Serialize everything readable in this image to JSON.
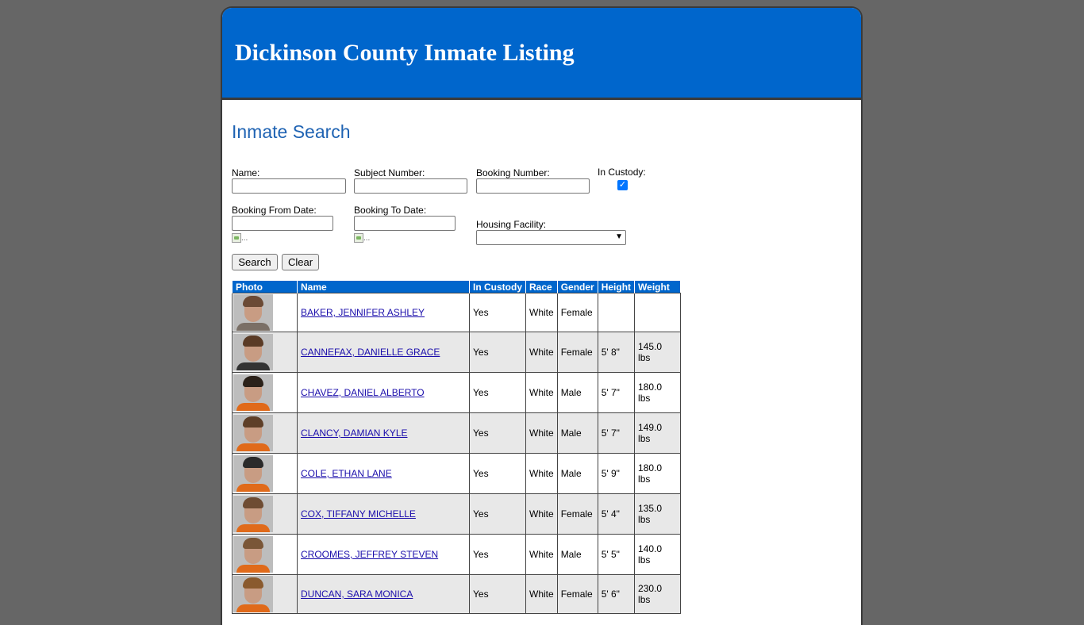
{
  "header": {
    "title": "Dickinson County Inmate Listing"
  },
  "search": {
    "title": "Inmate Search",
    "name_label": "Name:",
    "subject_label": "Subject Number:",
    "booking_label": "Booking Number:",
    "custody_label": "In Custody:",
    "from_label": "Booking From Date:",
    "to_label": "Booking To Date:",
    "housing_label": "Housing Facility:",
    "cal_alt": "...",
    "search_button": "Search",
    "clear_button": "Clear",
    "in_custody_checked": true
  },
  "table": {
    "headers": [
      "Photo",
      "Name",
      "In Custody",
      "Race",
      "Gender",
      "Height",
      "Weight"
    ],
    "rows": [
      {
        "name": "BAKER, JENNIFER ASHLEY",
        "custody": "Yes",
        "race": "White",
        "gender": "Female",
        "height": "",
        "weight": "",
        "hair": "#6b4a35",
        "shirt": "#7a6f66"
      },
      {
        "name": "CANNEFAX, DANIELLE GRACE",
        "custody": "Yes",
        "race": "White",
        "gender": "Female",
        "height": "5' 8\"",
        "weight": "145.0 lbs",
        "hair": "#5a3b26",
        "shirt": "#333333"
      },
      {
        "name": "CHAVEZ, DANIEL ALBERTO",
        "custody": "Yes",
        "race": "White",
        "gender": "Male",
        "height": "5' 7\"",
        "weight": "180.0 lbs",
        "hair": "#2b2119",
        "shirt": "#e06a1a"
      },
      {
        "name": "CLANCY, DAMIAN KYLE",
        "custody": "Yes",
        "race": "White",
        "gender": "Male",
        "height": "5' 7\"",
        "weight": "149.0 lbs",
        "hair": "#5e3f28",
        "shirt": "#e06a1a"
      },
      {
        "name": "COLE, ETHAN LANE",
        "custody": "Yes",
        "race": "White",
        "gender": "Male",
        "height": "5' 9\"",
        "weight": "180.0 lbs",
        "hair": "#2a2a2a",
        "shirt": "#e06a1a"
      },
      {
        "name": "COX, TIFFANY MICHELLE",
        "custody": "Yes",
        "race": "White",
        "gender": "Female",
        "height": "5' 4\"",
        "weight": "135.0 lbs",
        "hair": "#6e4c33",
        "shirt": "#e06a1a"
      },
      {
        "name": "CROOMES, JEFFREY STEVEN",
        "custody": "Yes",
        "race": "White",
        "gender": "Male",
        "height": "5' 5\"",
        "weight": "140.0 lbs",
        "hair": "#7a5637",
        "shirt": "#e06a1a"
      },
      {
        "name": "DUNCAN, SARA MONICA",
        "custody": "Yes",
        "race": "White",
        "gender": "Female",
        "height": "5' 6\"",
        "weight": "230.0 lbs",
        "hair": "#8a5a2e",
        "shirt": "#e06a1a"
      }
    ]
  }
}
